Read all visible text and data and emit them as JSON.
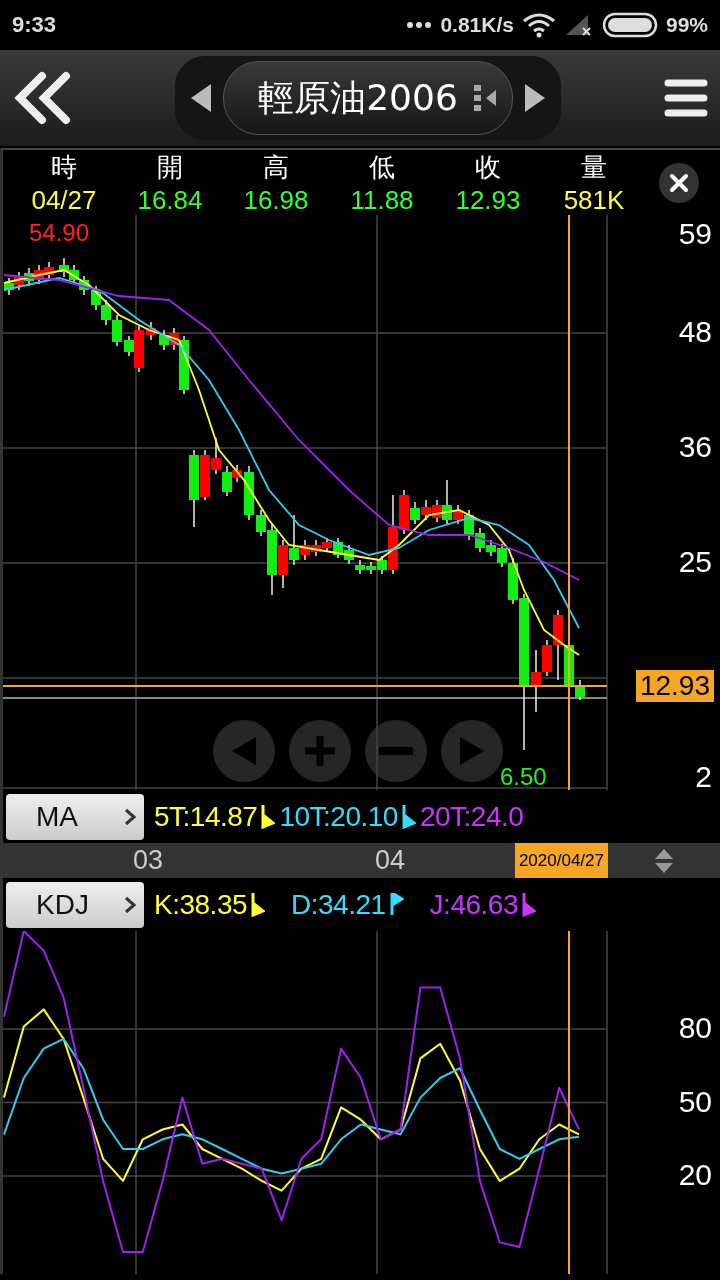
{
  "status_bar": {
    "time": "9:33",
    "speed": "0.81K/s",
    "battery": "99%"
  },
  "header": {
    "title": "輕原油2006"
  },
  "quote": [
    {
      "label": "時",
      "value": "04/27",
      "color": "#ffff33"
    },
    {
      "label": "開",
      "value": "16.84",
      "color": "#33ff33"
    },
    {
      "label": "高",
      "value": "16.98",
      "color": "#33ff33"
    },
    {
      "label": "低",
      "value": "11.88",
      "color": "#33ff33"
    },
    {
      "label": "收",
      "value": "12.93",
      "color": "#33ff33"
    },
    {
      "label": "量",
      "value": "581K",
      "color": "#ffff33"
    }
  ],
  "price_chart": {
    "high_label": "54.90",
    "low_label": "6.50",
    "axis_labels": [
      "59",
      "48",
      "36",
      "25",
      "2"
    ],
    "current_price": "12.93"
  },
  "ma_row": {
    "button": "MA",
    "items": [
      {
        "text": "5T:14.87",
        "color": "#ffff33",
        "falling": true
      },
      {
        "text": "10T:20.10",
        "color": "#33ddff",
        "falling": true
      },
      {
        "text": "20T:24.0",
        "color": "#cc33ff"
      }
    ]
  },
  "date_axis": {
    "labels": [
      "03",
      "04"
    ],
    "cursor_date": "2020/04/27"
  },
  "kdj_row": {
    "button": "KDJ",
    "items": [
      {
        "text": "K:38.35",
        "color": "#ffff33",
        "falling": true
      },
      {
        "text": "D:34.21",
        "color": "#33ddff",
        "falling": false
      },
      {
        "text": "J:46.63",
        "color": "#cc33ff",
        "falling": true
      }
    ]
  },
  "kdj_chart": {
    "chart_data": {
      "type": "line",
      "grid": true,
      "ylim": [
        -20,
        120
      ],
      "yticks": [
        20,
        50,
        80
      ],
      "series": [
        {
          "color": "#ffff33",
          "values": [
            52,
            81,
            88,
            76,
            52,
            27,
            18,
            35,
            39,
            41,
            31,
            27,
            23,
            18,
            14,
            23,
            27,
            48,
            43,
            35,
            39,
            68,
            74,
            59,
            31,
            18,
            23,
            35,
            41,
            37
          ]
        },
        {
          "color": "#33ccee",
          "values": [
            37,
            60,
            72,
            76,
            64,
            43,
            31,
            31,
            35,
            37,
            35,
            31,
            27,
            23,
            21,
            23,
            25,
            35,
            41,
            39,
            37,
            52,
            60,
            64,
            47,
            31,
            27,
            31,
            35,
            36
          ]
        },
        {
          "color": "#a020f0",
          "values": [
            85,
            120,
            112,
            93,
            56,
            18,
            -11,
            -11,
            18,
            52,
            25,
            27,
            25,
            23,
            2,
            27,
            35,
            72,
            60,
            35,
            39,
            97,
            97,
            68,
            18,
            -7,
            -9,
            23,
            56,
            39
          ]
        }
      ]
    }
  }
}
